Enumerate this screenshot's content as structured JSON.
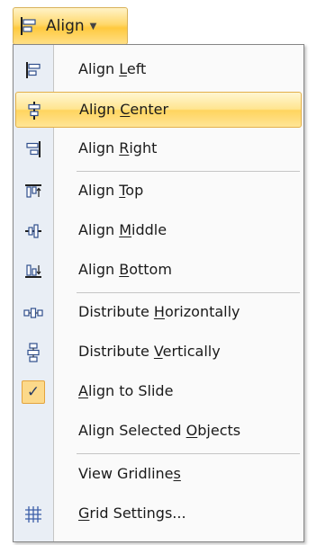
{
  "ribbon": {
    "align_button_label": "Align",
    "align_button_icon": "align-left-icon",
    "caret_icon": "chevron-down-icon"
  },
  "menu": {
    "items": [
      {
        "label_pre": "Align ",
        "accel": "L",
        "label_post": "eft",
        "icon": "align-left-icon"
      },
      {
        "label_pre": "Align ",
        "accel": "C",
        "label_post": "enter",
        "icon": "align-center-icon",
        "highlighted": true
      },
      {
        "label_pre": "Align ",
        "accel": "R",
        "label_post": "ight",
        "icon": "align-right-icon"
      },
      {
        "label_pre": "Align ",
        "accel": "T",
        "label_post": "op",
        "icon": "align-top-icon"
      },
      {
        "label_pre": "Align ",
        "accel": "M",
        "label_post": "iddle",
        "icon": "align-middle-icon"
      },
      {
        "label_pre": "Align ",
        "accel": "B",
        "label_post": "ottom",
        "icon": "align-bottom-icon"
      },
      {
        "label_pre": "Distribute ",
        "accel": "H",
        "label_post": "orizontally",
        "icon": "distribute-horizontally-icon"
      },
      {
        "label_pre": "Distribute ",
        "accel": "V",
        "label_post": "ertically",
        "icon": "distribute-vertically-icon"
      },
      {
        "label_pre": "",
        "accel": "A",
        "label_post": "lign to Slide",
        "icon": "checkmark-icon",
        "checked": true
      },
      {
        "label_pre": "Align Selected ",
        "accel": "O",
        "label_post": "bjects",
        "checked": false
      },
      {
        "label_pre": "View Gridline",
        "accel": "s",
        "label_post": ""
      },
      {
        "label_pre": "",
        "accel": "G",
        "label_post": "rid Settings...",
        "icon": "grid-icon"
      }
    ]
  },
  "colors": {
    "highlight": "#ffe590",
    "highlight_border": "#e3b04b",
    "icon_blue": "#2f4e8c",
    "gutter": "#e9eef5"
  }
}
